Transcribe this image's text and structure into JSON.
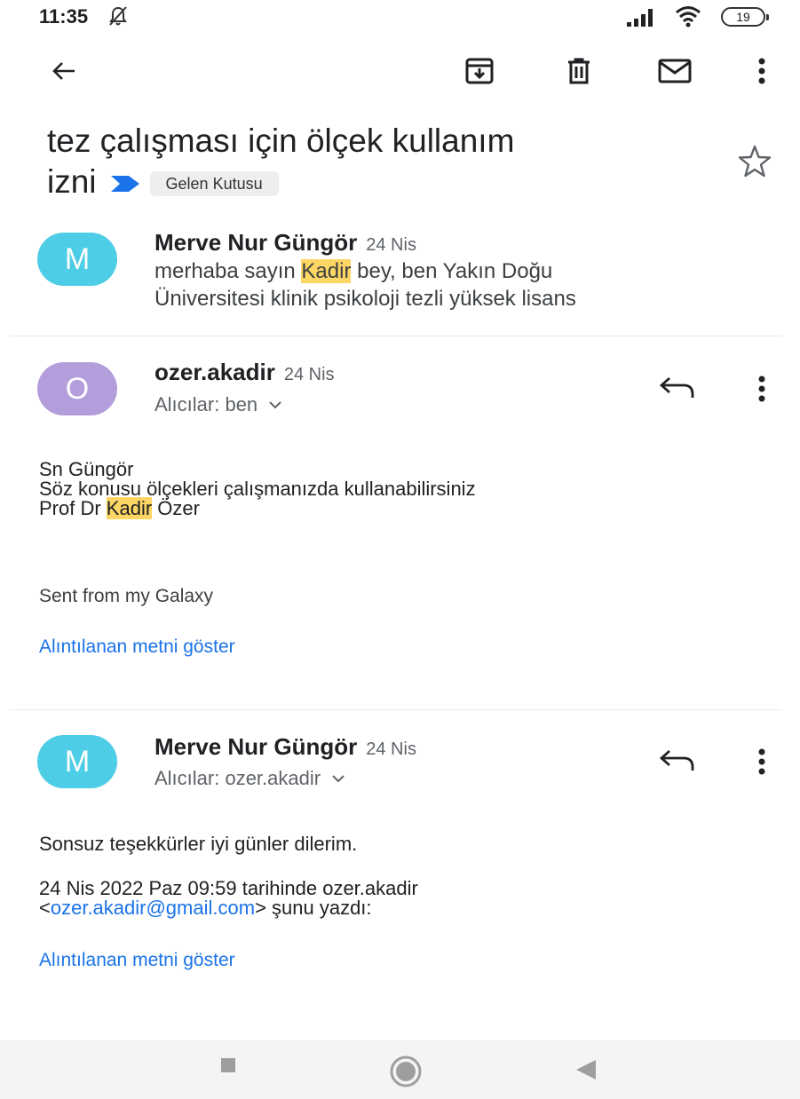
{
  "status_bar": {
    "time": "11:35",
    "battery": "19",
    "icons": [
      "mute-icon",
      "signal-icon",
      "wifi-icon",
      "battery-icon"
    ]
  },
  "toolbar": {
    "icons": [
      "back-arrow-icon",
      "archive-icon",
      "delete-icon",
      "mark-unread-icon",
      "more-vert-icon"
    ]
  },
  "thread": {
    "subject_line1": "tez çalışması için ölçek kullanım",
    "subject_line2": "izni",
    "label": "Gelen Kutusu"
  },
  "messages": [
    {
      "avatar_letter": "M",
      "avatar_color": "#4ecde6",
      "sender": "Merve Nur Güngör",
      "date": "24 Nis",
      "snippet_before": "merhaba sayın ",
      "snippet_highlight": "Kadir",
      "snippet_after": " bey, ben Yakın Doğu",
      "snippet_line2": "Üniversitesi klinik psikoloji tezli yüksek lisans"
    },
    {
      "avatar_letter": "O",
      "avatar_color": "#b39ddb",
      "sender": "ozer.akadir",
      "date": "24 Nis",
      "recipients": "Alıcılar: ben",
      "body_line1": "Sn Güngör",
      "body_line2": "Söz konusu ölçekleri çalışmanızda kullanabilirsiniz",
      "body_line3_before": "Prof Dr ",
      "body_line3_highlight": "Kadir",
      "body_line3_after": " Özer",
      "signature": "Sent from my Galaxy",
      "show_quoted": "Alıntılanan metni göster"
    },
    {
      "avatar_letter": "M",
      "avatar_color": "#4ecde6",
      "sender": "Merve Nur Güngör",
      "date": "24 Nis",
      "recipients": "Alıcılar: ozer.akadir",
      "body_line1": "Sonsuz teşekkürler iyi günler dilerim.",
      "quote_header_line1": "24 Nis 2022 Paz 09:59 tarihinde ozer.akadir",
      "quote_lt": "<",
      "quote_email": "ozer.akadir@gmail.com",
      "quote_after": "> şunu yazdı:",
      "show_quoted": "Alıntılanan metni göster"
    }
  ],
  "nav_bar": {
    "icons": [
      "recents-icon",
      "home-icon",
      "back-icon"
    ]
  },
  "colors": {
    "highlight": "#fdd663",
    "link": "#1a73e8",
    "important_marker": "#1a73e8"
  }
}
